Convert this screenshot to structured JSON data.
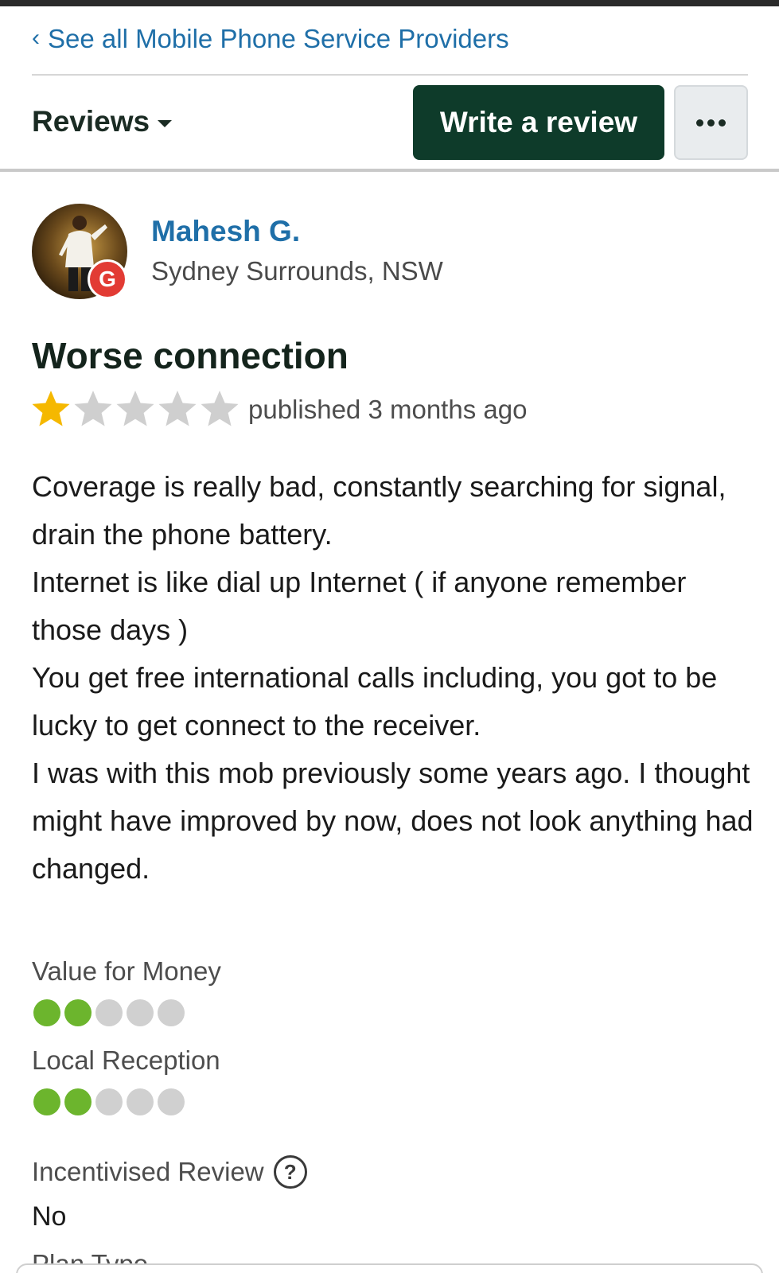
{
  "nav": {
    "back_chevron": "‹",
    "back_label": "See all Mobile Phone Service Providers"
  },
  "toolbar": {
    "reviews_label": "Reviews",
    "write_review_label": "Write a review",
    "more_icon": "more-horizontal-icon"
  },
  "reviewer": {
    "name": "Mahesh G.",
    "location": "Sydney Surrounds, NSW",
    "badge_letter": "G"
  },
  "review": {
    "title": "Worse connection",
    "rating": 1,
    "max_rating": 5,
    "published": "published 3 months ago",
    "body_lines": [
      "Coverage is really bad, constantly searching for signal,",
      "drain the phone battery.",
      "Internet is like dial up Internet ( if anyone remember those days )",
      "You get free international calls including, you got to be lucky to get connect to the receiver.",
      "I was with this mob previously some years ago. I thought might have improved by now, does not look anything had changed."
    ]
  },
  "metrics": [
    {
      "label": "Value for Money",
      "score": 2,
      "max": 5
    },
    {
      "label": "Local Reception",
      "score": 2,
      "max": 5
    }
  ],
  "incentivised": {
    "label": "Incentivised Review",
    "help_icon": "?",
    "value": "No"
  },
  "plan_type": {
    "label": "Plan Type"
  },
  "colors": {
    "accent_link": "#1f6fa8",
    "primary_button": "#0e3b2a",
    "star_filled": "#f5b800",
    "star_empty": "#cfcfcf",
    "dot_on": "#6cb52d",
    "dot_off": "#d0d0d0",
    "google_badge": "#e23b34"
  }
}
